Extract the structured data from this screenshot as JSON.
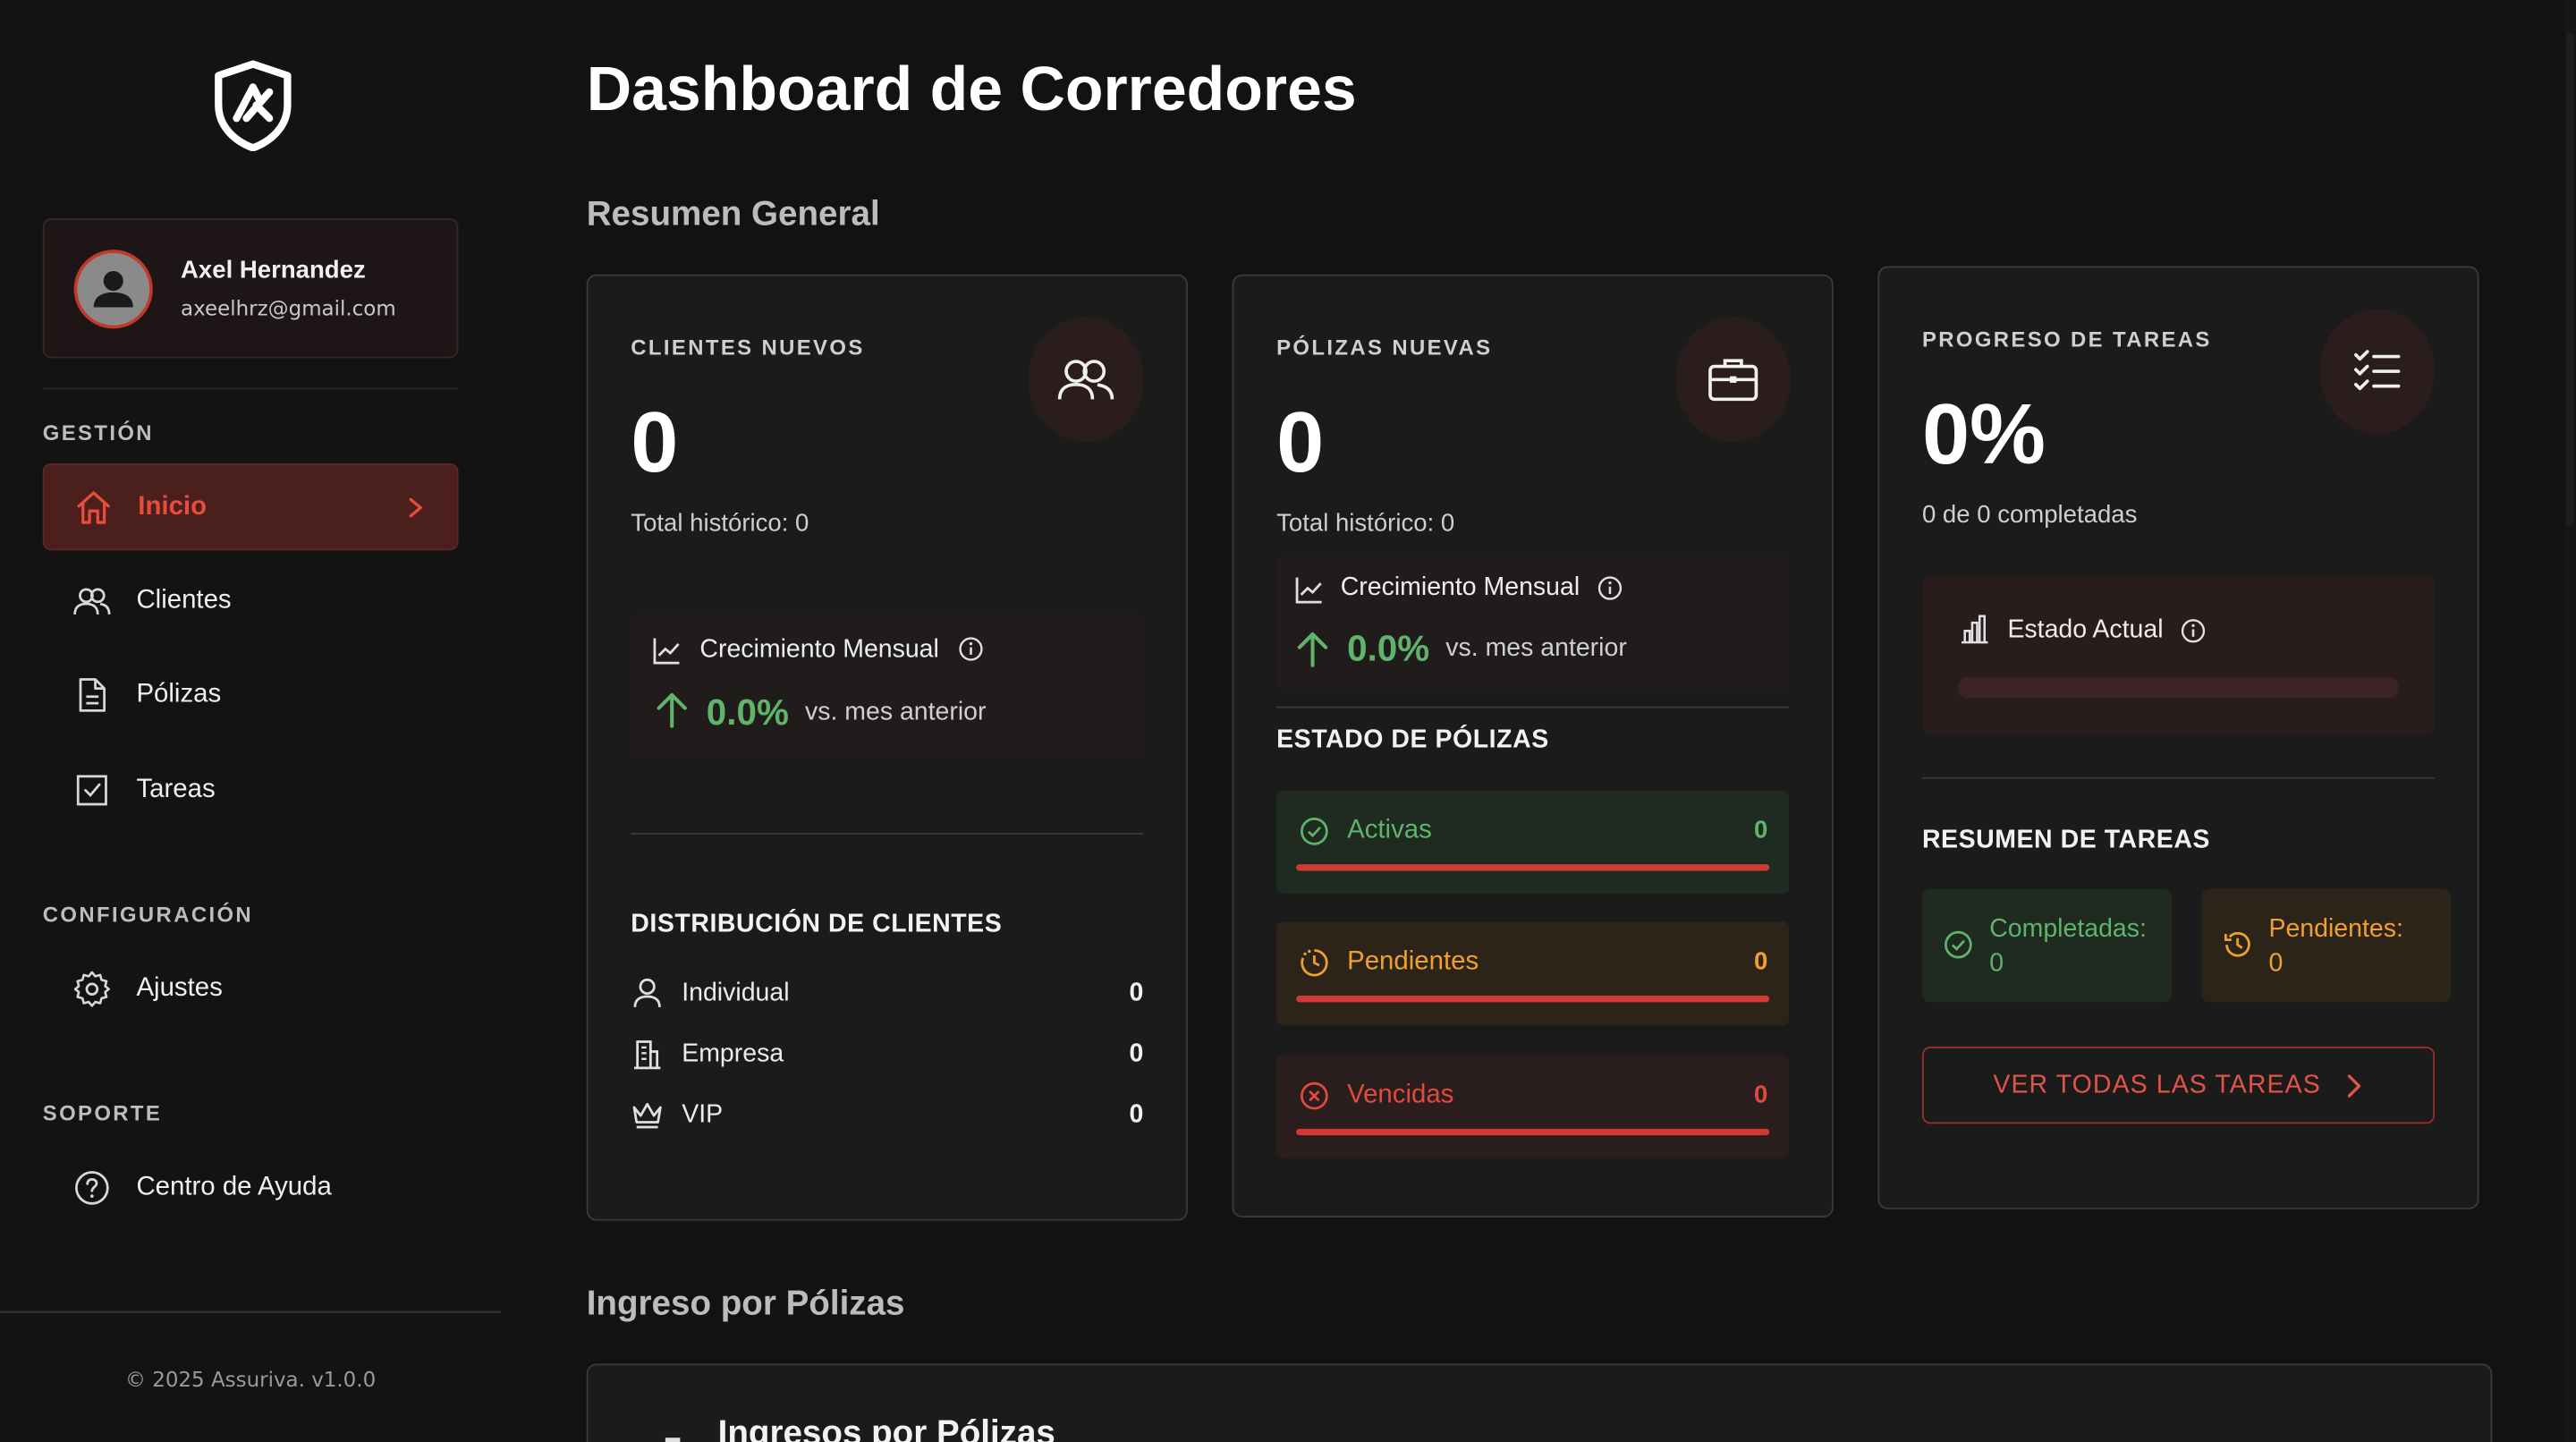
{
  "sidebar": {
    "user": {
      "name": "Axel Hernandez",
      "email": "axeelhrz@gmail.com"
    },
    "sections": [
      {
        "label": "GESTIÓN"
      },
      {
        "label": "CONFIGURACIÓN"
      },
      {
        "label": "SOPORTE"
      }
    ],
    "items": [
      {
        "label": "Inicio",
        "icon": "home-icon",
        "active": true
      },
      {
        "label": "Clientes",
        "icon": "users-icon"
      },
      {
        "label": "Pólizas",
        "icon": "document-icon"
      },
      {
        "label": "Tareas",
        "icon": "checkbox-icon"
      },
      {
        "label": "Ajustes",
        "icon": "gear-icon"
      },
      {
        "label": "Centro de Ayuda",
        "icon": "help-icon"
      }
    ],
    "copyright": "© 2025 Assuriva. v1.0.0"
  },
  "page": {
    "title": "Dashboard de Corredores",
    "section_overview": "Resumen General",
    "section_income": "Ingreso por Pólizas"
  },
  "clients_card": {
    "label": "CLIENTES NUEVOS",
    "value": "0",
    "total": "Total histórico: 0",
    "growth_title": "Crecimiento Mensual",
    "growth_value": "0.0%",
    "growth_compare": "vs. mes anterior",
    "distribution_title": "DISTRIBUCIÓN DE CLIENTES",
    "distribution": [
      {
        "label": "Individual",
        "value": "0",
        "icon": "person-icon"
      },
      {
        "label": "Empresa",
        "value": "0",
        "icon": "building-icon"
      },
      {
        "label": "VIP",
        "value": "0",
        "icon": "crown-icon"
      }
    ]
  },
  "policies_card": {
    "label": "PÓLIZAS NUEVAS",
    "value": "0",
    "total": "Total histórico: 0",
    "growth_title": "Crecimiento Mensual",
    "growth_value": "0.0%",
    "growth_compare": "vs. mes anterior",
    "status_title": "ESTADO DE PÓLIZAS",
    "statuses": [
      {
        "label": "Activas",
        "value": "0",
        "color": "#5fb36a"
      },
      {
        "label": "Pendientes",
        "value": "0",
        "color": "#f0a030"
      },
      {
        "label": "Vencidas",
        "value": "0",
        "color": "#e04a3f"
      }
    ]
  },
  "tasks_card": {
    "label": "PROGRESO DE TAREAS",
    "value": "0%",
    "completed_text": "0 de 0 completadas",
    "status_title": "Estado Actual",
    "progress": 0,
    "summary_title": "RESUMEN DE TAREAS",
    "completed_label": "Completadas:",
    "completed_value": "0",
    "pending_label": "Pendientes:",
    "pending_value": "0",
    "view_all": "VER TODAS LAS TAREAS"
  },
  "income_card": {
    "title": "Ingresos por Pólizas"
  },
  "colors": {
    "accent": "#e74c3c",
    "success": "#5fb36a",
    "warning": "#f0a030",
    "danger": "#e04a3f"
  }
}
